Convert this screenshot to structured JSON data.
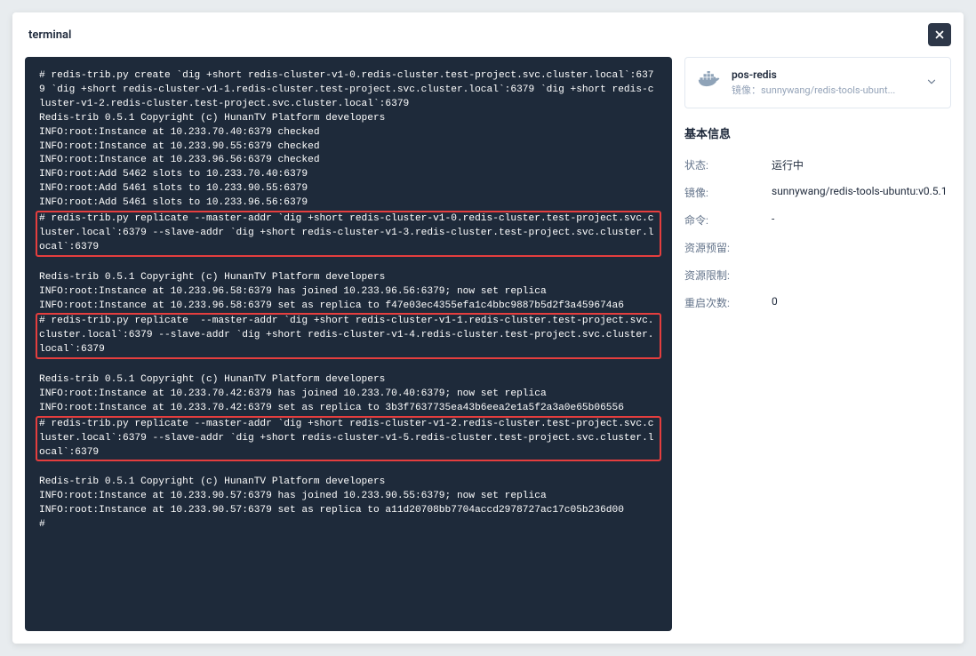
{
  "modal": {
    "title": "terminal"
  },
  "terminal": {
    "lines": [
      {
        "t": "# redis-trib.py create `dig +short redis-cluster-v1-0.redis-cluster.test-project.svc.cluster.local`:6379 `dig +short redis-cluster-v1-1.redis-cluster.test-project.svc.cluster.local`:6379 `dig +short redis-cluster-v1-2.redis-cluster.test-project.svc.cluster.local`:6379",
        "hl": false
      },
      {
        "t": "Redis-trib 0.5.1 Copyright (c) HunanTV Platform developers",
        "hl": false
      },
      {
        "t": "INFO:root:Instance at 10.233.70.40:6379 checked",
        "hl": false
      },
      {
        "t": "INFO:root:Instance at 10.233.90.55:6379 checked",
        "hl": false
      },
      {
        "t": "INFO:root:Instance at 10.233.96.56:6379 checked",
        "hl": false
      },
      {
        "t": "INFO:root:Add 5462 slots to 10.233.70.40:6379",
        "hl": false
      },
      {
        "t": "INFO:root:Add 5461 slots to 10.233.90.55:6379",
        "hl": false
      },
      {
        "t": "INFO:root:Add 5461 slots to 10.233.96.56:6379",
        "hl": false
      },
      {
        "t": "# redis-trib.py replicate --master-addr `dig +short redis-cluster-v1-0.redis-cluster.test-project.svc.cluster.local`:6379 --slave-addr `dig +short redis-cluster-v1-3.redis-cluster.test-project.svc.cluster.local`:6379",
        "hl": true
      },
      {
        "t": "Redis-trib 0.5.1 Copyright (c) HunanTV Platform developers",
        "hl": false
      },
      {
        "t": "INFO:root:Instance at 10.233.96.58:6379 has joined 10.233.96.56:6379; now set replica",
        "hl": false
      },
      {
        "t": "INFO:root:Instance at 10.233.96.58:6379 set as replica to f47e03ec4355efa1c4bbc9887b5d2f3a459674a6",
        "hl": false
      },
      {
        "t": "# redis-trib.py replicate  --master-addr `dig +short redis-cluster-v1-1.redis-cluster.test-project.svc.cluster.local`:6379 --slave-addr `dig +short redis-cluster-v1-4.redis-cluster.test-project.svc.cluster.local`:6379",
        "hl": true
      },
      {
        "t": "Redis-trib 0.5.1 Copyright (c) HunanTV Platform developers",
        "hl": false
      },
      {
        "t": "INFO:root:Instance at 10.233.70.42:6379 has joined 10.233.70.40:6379; now set replica",
        "hl": false
      },
      {
        "t": "INFO:root:Instance at 10.233.70.42:6379 set as replica to 3b3f7637735ea43b6eea2e1a5f2a3a0e65b06556",
        "hl": false
      },
      {
        "t": "# redis-trib.py replicate --master-addr `dig +short redis-cluster-v1-2.redis-cluster.test-project.svc.cluster.local`:6379 --slave-addr `dig +short redis-cluster-v1-5.redis-cluster.test-project.svc.cluster.local`:6379",
        "hl": true
      },
      {
        "t": "Redis-trib 0.5.1 Copyright (c) HunanTV Platform developers",
        "hl": false
      },
      {
        "t": "INFO:root:Instance at 10.233.90.57:6379 has joined 10.233.90.55:6379; now set replica",
        "hl": false
      },
      {
        "t": "INFO:root:Instance at 10.233.90.57:6379 set as replica to a11d20708bb7704accd2978727ac17c05b236d00",
        "hl": false
      },
      {
        "t": "#",
        "hl": false
      }
    ]
  },
  "pod": {
    "name": "pos-redis",
    "image_label_prefix": "镜像：",
    "image_short": "sunnywang/redis-tools-ubunt..."
  },
  "info": {
    "title": "基本信息",
    "rows": [
      {
        "label": "状态:",
        "value": "运行中"
      },
      {
        "label": "镜像:",
        "value": "sunnywang/redis-tools-ubuntu:v0.5.1"
      },
      {
        "label": "命令:",
        "value": "-"
      },
      {
        "label": "资源预留:",
        "value": ""
      },
      {
        "label": "资源限制:",
        "value": ""
      },
      {
        "label": "重启次数:",
        "value": "0"
      }
    ]
  }
}
